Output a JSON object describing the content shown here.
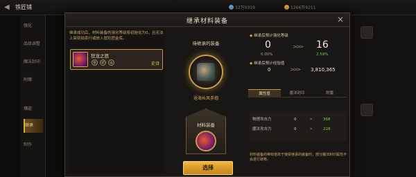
{
  "app": {
    "title": "铁匠铺",
    "resources": [
      "32万0319",
      "1266万9211"
    ]
  },
  "sidebar": {
    "items": [
      {
        "label": "强化"
      },
      {
        "label": "品级调整"
      },
      {
        "label": "魔法封印"
      },
      {
        "label": "附魔"
      },
      {
        "label": "镶嵌"
      },
      {
        "label": "继承"
      },
      {
        "label": "制作"
      }
    ],
    "active_index": 5
  },
  "modal": {
    "title": "继承材料装备",
    "close_label": "×",
    "notice": "继承成功后，材料装备的强化等级将初始化为0，且无法上架到拍卖行或放入冒险团金库。",
    "material_item": {
      "name": "狂龙之怒",
      "tags": [
        "♀",
        "♂",
        "⌂"
      ],
      "rarity": "史诗"
    },
    "center": {
      "target_label": "待继承的装备",
      "target_name": "沧海长风手炮",
      "material_label": "材料装备"
    },
    "right": {
      "level_label": "继承后预计强化等级",
      "level_from": "0",
      "level_from_pct": "0.00%",
      "level_to": "16",
      "level_to_pct": "2.59%",
      "exp_label": "继承后预计经验值",
      "exp_from": "0",
      "exp_to": "3,810,365",
      "tabs": [
        "属性值",
        "魔法封印",
        "附魔"
      ],
      "active_tab": 0,
      "stats": [
        {
          "name": "物理攻击力",
          "from": "0",
          "to": "368"
        },
        {
          "name": "魔法攻击力",
          "from": "0",
          "to": "228"
        }
      ],
      "footnote": "材料装备的稀有度高于接受继承的装备时，部分魔法封印属性不会进行转移。"
    },
    "select_label": "选择"
  },
  "colors": {
    "accent_gold": "#e0a93c",
    "increase_green": "#7ed04e"
  }
}
